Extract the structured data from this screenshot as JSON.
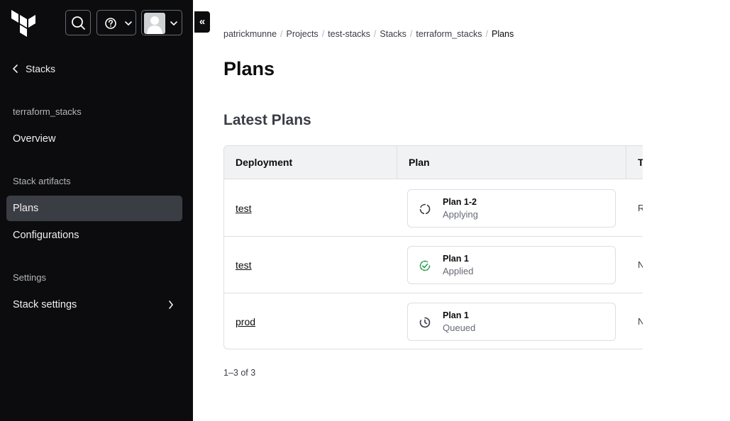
{
  "header": {
    "help_chevron": "⌄",
    "user_chevron": "⌄",
    "collapse_label": "«"
  },
  "sidebar": {
    "back_label": "Stacks",
    "stack_name": "terraform_stacks",
    "overview_label": "Overview",
    "artifacts_heading": "Stack artifacts",
    "items": [
      {
        "label": "Plans"
      },
      {
        "label": "Configurations"
      }
    ],
    "settings_heading": "Settings",
    "stack_settings_label": "Stack settings"
  },
  "breadcrumb": [
    {
      "label": "patrickmunne"
    },
    {
      "label": "Projects"
    },
    {
      "label": "test-stacks"
    },
    {
      "label": "Stacks"
    },
    {
      "label": "terraform_stacks"
    },
    {
      "label": "Plans"
    }
  ],
  "page": {
    "title": "Plans",
    "section_title": "Latest Plans"
  },
  "table": {
    "headers": {
      "deployment": "Deployment",
      "plan": "Plan",
      "third": "T"
    },
    "rows": [
      {
        "deployment": "test",
        "plan_name": "Plan 1-2",
        "plan_status": "Applying",
        "third": "R"
      },
      {
        "deployment": "test",
        "plan_name": "Plan 1",
        "plan_status": "Applied",
        "third": "N"
      },
      {
        "deployment": "prod",
        "plan_name": "Plan 1",
        "plan_status": "Queued",
        "third": "N"
      }
    ]
  },
  "pagination": {
    "info": "1–3 of 3"
  },
  "colors": {
    "sidebar_bg": "#0c0c0e",
    "active_item_bg": "#3b3d45",
    "applied_green": "#2e9b4d",
    "header_bg": "#f1f2f3"
  }
}
